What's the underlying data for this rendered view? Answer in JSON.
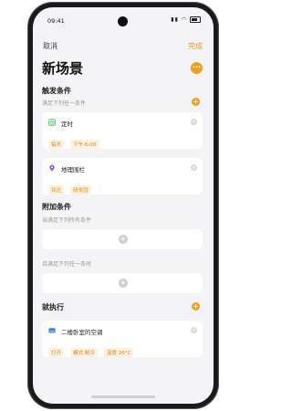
{
  "status": {
    "time": "09:41"
  },
  "nav": {
    "cancel": "取消",
    "done": "完成"
  },
  "page": {
    "title": "新场景",
    "more_icon": "more-icon"
  },
  "trigger": {
    "title": "触发条件",
    "subtitle": "满足下列任一条件",
    "cards": [
      {
        "title": "定时",
        "icon": "alarm-clock-icon",
        "tags": [
          "每天",
          "下午 6:00"
        ]
      },
      {
        "title": "地理围栏",
        "icon": "location-pin-icon",
        "tags": [
          "到达",
          "研发园"
        ]
      }
    ]
  },
  "additional": {
    "title": "附加条件",
    "subtitle_all": "当满足下列所有条件",
    "subtitle_any": "且满足下列任一条时"
  },
  "action": {
    "title": "就执行",
    "card": {
      "title": "二楼卧室的空调",
      "icon": "air-conditioner-icon",
      "tags": [
        "打开",
        "模式 制冷",
        "温度 26°C"
      ]
    }
  },
  "colors": {
    "accent": "#f0a020",
    "tag_bg": "#fdf1df",
    "tag_text": "#d98a1a"
  }
}
